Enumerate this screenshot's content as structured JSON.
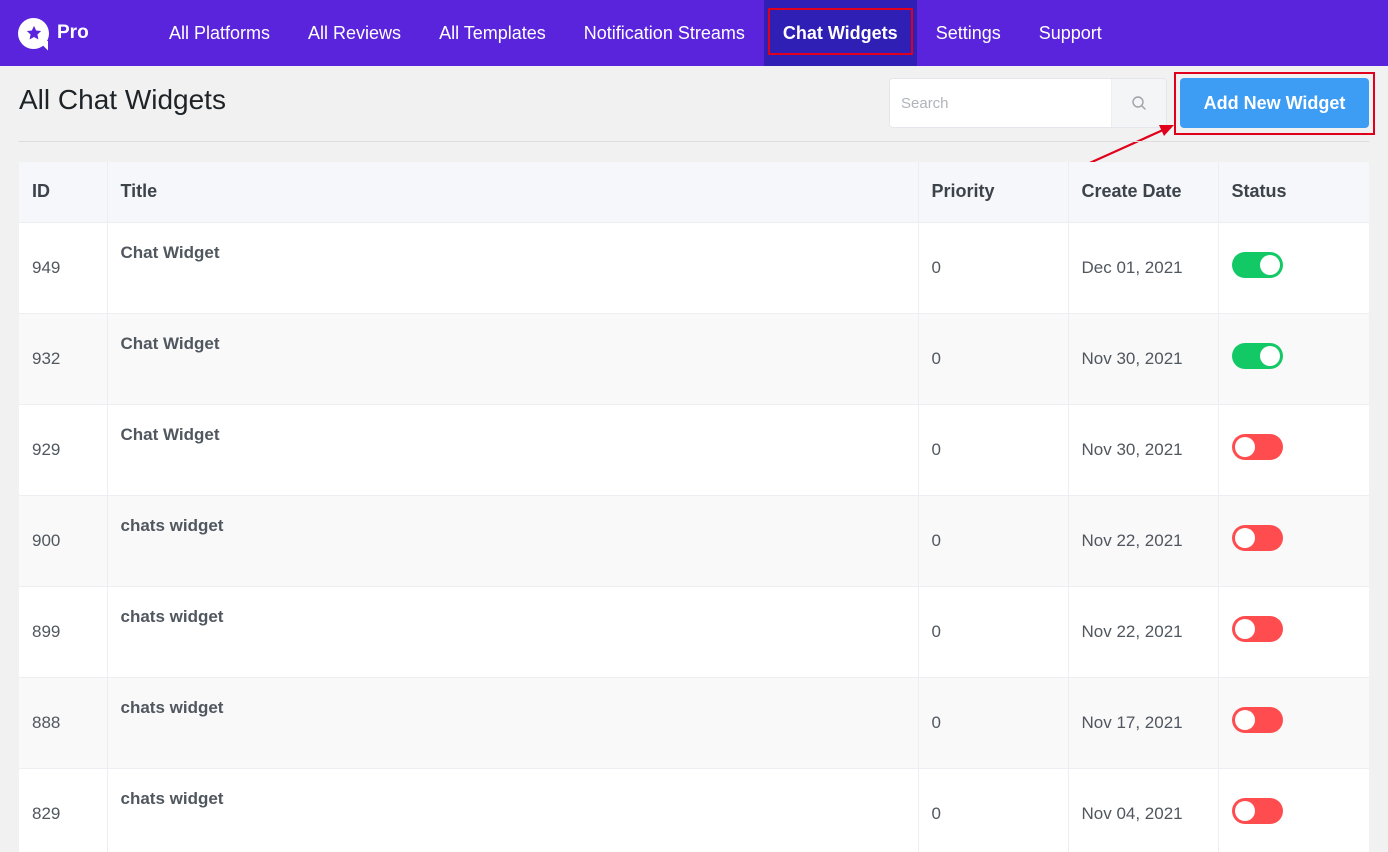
{
  "brand": {
    "name": "Pro"
  },
  "nav": {
    "items": [
      {
        "label": "All Platforms",
        "active": false
      },
      {
        "label": "All Reviews",
        "active": false
      },
      {
        "label": "All Templates",
        "active": false
      },
      {
        "label": "Notification Streams",
        "active": false
      },
      {
        "label": "Chat Widgets",
        "active": true
      },
      {
        "label": "Settings",
        "active": false
      },
      {
        "label": "Support",
        "active": false
      }
    ]
  },
  "page": {
    "title": "All Chat Widgets"
  },
  "search": {
    "placeholder": "Search",
    "value": ""
  },
  "actions": {
    "add_label": "Add New Widget"
  },
  "colors": {
    "topbar": "#5a24dc",
    "nav_active": "#2f1fb4",
    "primary_button": "#3d9df5",
    "toggle_on": "#13c966",
    "toggle_off": "#ff4d4f",
    "highlight": "#e0001b"
  },
  "table": {
    "columns": [
      "ID",
      "Title",
      "Priority",
      "Create Date",
      "Status"
    ],
    "rows": [
      {
        "id": "949",
        "title": "Chat Widget",
        "priority": "0",
        "date": "Dec 01, 2021",
        "status": "on"
      },
      {
        "id": "932",
        "title": "Chat Widget",
        "priority": "0",
        "date": "Nov 30, 2021",
        "status": "on"
      },
      {
        "id": "929",
        "title": "Chat Widget",
        "priority": "0",
        "date": "Nov 30, 2021",
        "status": "off"
      },
      {
        "id": "900",
        "title": "chats widget",
        "priority": "0",
        "date": "Nov 22, 2021",
        "status": "off"
      },
      {
        "id": "899",
        "title": "chats widget",
        "priority": "0",
        "date": "Nov 22, 2021",
        "status": "off"
      },
      {
        "id": "888",
        "title": "chats widget",
        "priority": "0",
        "date": "Nov 17, 2021",
        "status": "off"
      },
      {
        "id": "829",
        "title": "chats widget",
        "priority": "0",
        "date": "Nov 04, 2021",
        "status": "off"
      }
    ]
  }
}
